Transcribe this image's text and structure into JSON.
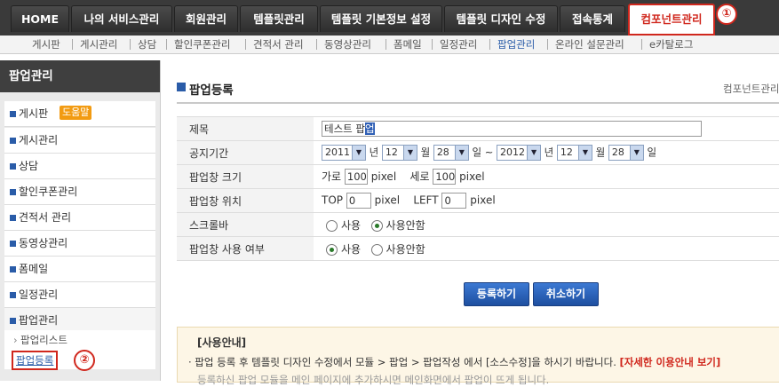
{
  "topnav": {
    "tabs": [
      "HOME",
      "나의 서비스관리",
      "회원관리",
      "템플릿관리",
      "템플릿 기본정보 설정",
      "템플릿 디자인 수정",
      "접속통계",
      "컴포넌트관리"
    ],
    "marker1": "①"
  },
  "subnav": {
    "items": [
      "게시판",
      "게시관리",
      "상담",
      "할인쿠폰관리",
      "견적서 관리",
      "동영상관리",
      "폼메일",
      "일정관리",
      "팝업관리",
      "온라인 설문관리",
      "e카탈로그"
    ]
  },
  "sidebar": {
    "title": "팝업관리",
    "help_badge": "도움말",
    "items": [
      "게시판",
      "게시관리",
      "상담",
      "할인쿠폰관리",
      "견적서 관리",
      "동영상관리",
      "폼메일",
      "일정관리",
      "팝업관리"
    ],
    "sub_items": [
      "팝업리스트",
      "팝업등록"
    ],
    "marker2": "②"
  },
  "main": {
    "title": "팝업등록",
    "breadcrumb": "컴포넌트관리",
    "form": {
      "subject_label": "제목",
      "subject_value_plain": "테스트 팝",
      "subject_value_selected": "업",
      "period_label": "공지기간",
      "start_year": "2011",
      "start_month": "12",
      "start_day": "28",
      "end_year": "2012",
      "end_month": "12",
      "end_day": "28",
      "year_unit": "년",
      "month_unit": "월",
      "day_unit": "일",
      "tilde": "~",
      "size_label": "팝업창 크기",
      "width_label": "가로",
      "width_value": "100",
      "height_label": "세로",
      "height_value": "100",
      "px": "pixel",
      "position_label": "팝업창 위치",
      "top_label": "TOP",
      "top_value": "0",
      "left_label": "LEFT",
      "left_value": "0",
      "scroll_label": "스크롤바",
      "use_label": "사용",
      "nouse_label": "사용안함",
      "enable_label": "팝업창 사용 여부"
    },
    "buttons": {
      "register": "등록하기",
      "cancel": "취소하기"
    },
    "guide": {
      "title": "[사용안내]",
      "line1": "· 팝업 등록 후 템플릿 디자인 수정에서 모듈 > 팝업 > 팝업작성 에서 [소스수정]을 하시기 바랍니다.",
      "line1_link": "[자세한 이용안내 보기]",
      "line2": "등록하신 팝업 모듈을 메인 페이지에 추가하시면 메인화면에서 팝업이 뜨게 됩니다."
    }
  },
  "colors": {
    "accent": "#2a5ca8",
    "highlight": "#d0271d"
  }
}
